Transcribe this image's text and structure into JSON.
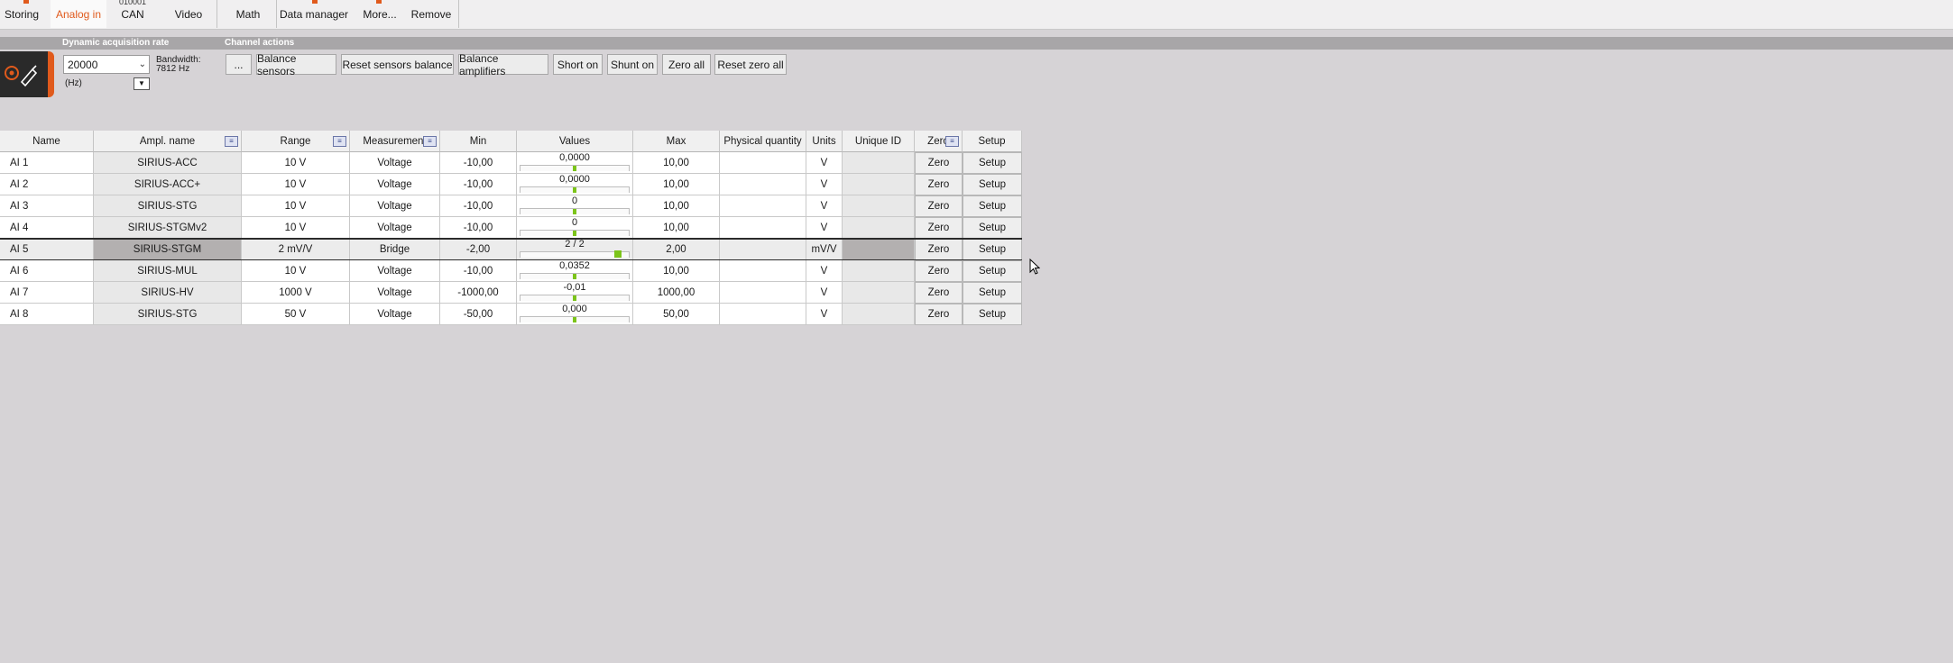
{
  "toolbar": {
    "items": [
      {
        "label": "Storing",
        "active": false
      },
      {
        "label": "Analog in",
        "active": true
      },
      {
        "label": "CAN",
        "active": false,
        "stub": "010001"
      },
      {
        "label": "Video",
        "active": false
      },
      {
        "label": "Math",
        "active": false
      },
      {
        "label": "Data manager",
        "active": false
      },
      {
        "label": "More...",
        "active": false
      },
      {
        "label": "Remove",
        "active": false
      }
    ],
    "accent_color": "#e05a1c"
  },
  "acquisition": {
    "title": "Dynamic acquisition rate",
    "rate_value": "20000",
    "unit": "(Hz)",
    "bandwidth_label": "Bandwidth:",
    "bandwidth_value": "7812 Hz"
  },
  "channel_actions": {
    "title": "Channel actions",
    "buttons": [
      "...",
      "Balance sensors",
      "Reset sensors balance",
      "Balance amplifiers",
      "Short on",
      "Shunt on",
      "Zero all",
      "Reset zero all"
    ]
  },
  "table": {
    "columns": [
      "Name",
      "Ampl. name",
      "Range",
      "Measurement",
      "Min",
      "Values",
      "Max",
      "Physical quantity",
      "Units",
      "Unique ID",
      "Zero",
      "Setup"
    ],
    "rows": [
      {
        "name": "AI 1",
        "ampl": "SIRIUS-ACC",
        "range": "10 V",
        "measurement": "Voltage",
        "min": "-10,00",
        "value": "0,0000",
        "value_pos": 0.5,
        "max": "10,00",
        "quantity": "",
        "units": "V",
        "uid": "",
        "zero": "Zero",
        "setup": "Setup",
        "selected": false
      },
      {
        "name": "AI 2",
        "ampl": "SIRIUS-ACC+",
        "range": "10 V",
        "measurement": "Voltage",
        "min": "-10,00",
        "value": "0,0000",
        "value_pos": 0.5,
        "max": "10,00",
        "quantity": "",
        "units": "V",
        "uid": "",
        "zero": "Zero",
        "setup": "Setup",
        "selected": false
      },
      {
        "name": "AI 3",
        "ampl": "SIRIUS-STG",
        "range": "10 V",
        "measurement": "Voltage",
        "min": "-10,00",
        "value": "0",
        "value_pos": 0.5,
        "max": "10,00",
        "quantity": "",
        "units": "V",
        "uid": "",
        "zero": "Zero",
        "setup": "Setup",
        "selected": false
      },
      {
        "name": "AI 4",
        "ampl": "SIRIUS-STGMv2",
        "range": "10 V",
        "measurement": "Voltage",
        "min": "-10,00",
        "value": "0",
        "value_pos": 0.5,
        "max": "10,00",
        "quantity": "",
        "units": "V",
        "uid": "",
        "zero": "Zero",
        "setup": "Setup",
        "selected": false
      },
      {
        "name": "AI 5",
        "ampl": "SIRIUS-STGM",
        "range": "2 mV/V",
        "measurement": "Bridge",
        "min": "-2,00",
        "value": "2 / 2",
        "value_pos": 0.93,
        "max": "2,00",
        "quantity": "",
        "units": "mV/V",
        "uid": "",
        "zero": "Zero",
        "setup": "Setup",
        "selected": true
      },
      {
        "name": "AI 6",
        "ampl": "SIRIUS-MUL",
        "range": "10 V",
        "measurement": "Voltage",
        "min": "-10,00",
        "value": "0,0352",
        "value_pos": 0.5,
        "max": "10,00",
        "quantity": "",
        "units": "V",
        "uid": "",
        "zero": "Zero",
        "setup": "Setup",
        "selected": false
      },
      {
        "name": "AI 7",
        "ampl": "SIRIUS-HV",
        "range": "1000 V",
        "measurement": "Voltage",
        "min": "-1000,00",
        "value": "-0,01",
        "value_pos": 0.5,
        "max": "1000,00",
        "quantity": "",
        "units": "V",
        "uid": "",
        "zero": "Zero",
        "setup": "Setup",
        "selected": false
      },
      {
        "name": "AI 8",
        "ampl": "SIRIUS-STG",
        "range": "50 V",
        "measurement": "Voltage",
        "min": "-50,00",
        "value": "0,000",
        "value_pos": 0.5,
        "max": "50,00",
        "quantity": "",
        "units": "V",
        "uid": "",
        "zero": "Zero",
        "setup": "Setup",
        "selected": false
      }
    ]
  }
}
